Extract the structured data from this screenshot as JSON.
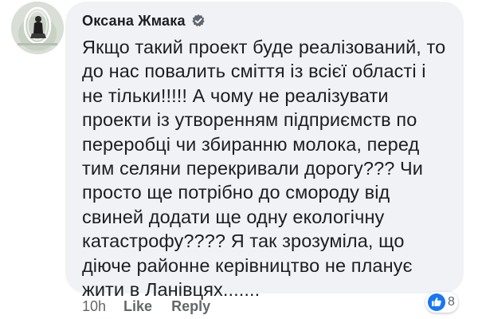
{
  "comment": {
    "author": "Оксана Жмака",
    "text": "Якщо такий проект буде реалізований, то\nдо нас повалить сміття із всієї області і\nне тільки!!!!! А чому не реалізувати\nпроекти із утворенням підприємств по\nпереробці чи збиранню молока, перед\nтим селяни перекривали дорогу??? Чи\nпросто ще потрібно до смороду від\nсвиней додати ще одну екологічну\nкатастрофу???? Я так зрозуміла, що\nдіюче районне керівництво не планує\nжити в Ланівцях.......",
    "timestamp": "10h",
    "like_label": "Like",
    "reply_label": "Reply",
    "reaction_count": "8",
    "reaction_icon": "like-icon"
  },
  "colors": {
    "bubble": "#f0f2f5",
    "text": "#1c1e21",
    "meta": "#65676b",
    "brand_blue": "#1877f2"
  }
}
